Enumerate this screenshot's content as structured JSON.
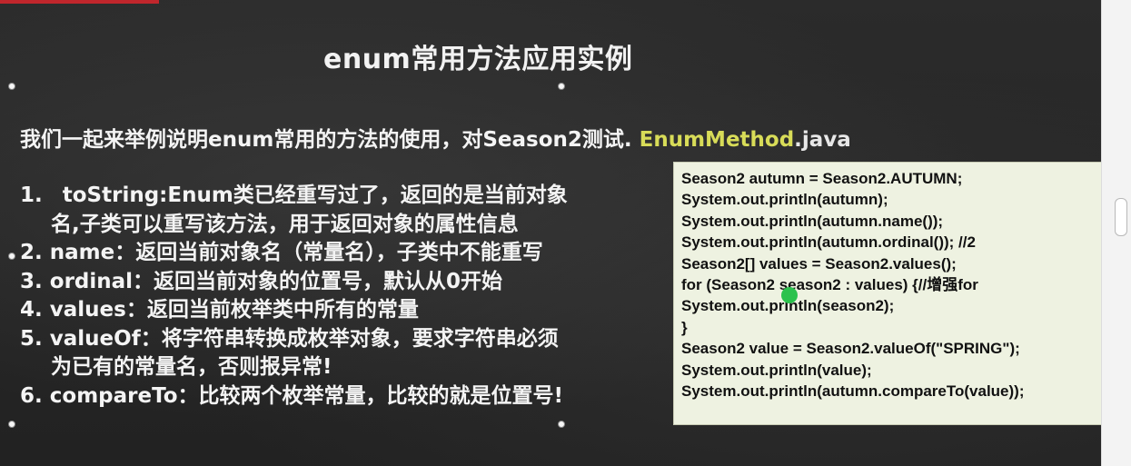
{
  "slide": {
    "title": "enum常用方法应用实例",
    "intro": {
      "text": "我们一起来举例说明enum常用的方法的使用，对Season2测试. ",
      "file_name": "EnumMethod",
      "file_ext": ".java"
    },
    "list": [
      {
        "num": "1.",
        "text": "toString:Enum类已经重写过了，返回的是当前对象",
        "cont": "名,子类可以重写该方法，用于返回对象的属性信息"
      },
      {
        "num": "2.",
        "text": "name：返回当前对象名（常量名），子类中不能重写"
      },
      {
        "num": "3.",
        "text": "ordinal：返回当前对象的位置号，默认从0开始"
      },
      {
        "num": "4.",
        "text": "values：返回当前枚举类中所有的常量"
      },
      {
        "num": "5.",
        "text": "valueOf：将字符串转换成枚举对象，要求字符串必须",
        "cont": "为已有的常量名，否则报异常!"
      },
      {
        "num": "6.",
        "text": "compareTo：比较两个枚举常量，比较的就是位置号!"
      }
    ],
    "code_lines": [
      "Season2 autumn = Season2.AUTUMN;",
      "System.out.println(autumn);",
      "System.out.println(autumn.name());",
      "System.out.println(autumn.ordinal()); //2",
      "Season2[] values = Season2.values();",
      "for (Season2 season2 : values) {//增强for",
      "System.out.println(season2);",
      "}",
      "Season2 value = Season2.valueOf(\"SPRING\");",
      "System.out.println(value);",
      "System.out.println(autumn.compareTo(value));"
    ]
  },
  "colors": {
    "accent_red": "#c0262c",
    "highlight_yellow": "#d8dc58",
    "code_bg": "#eef2e1",
    "cursor_green": "#2bc24d"
  },
  "icons": [
    "selection-handle",
    "cursor-indicator"
  ]
}
